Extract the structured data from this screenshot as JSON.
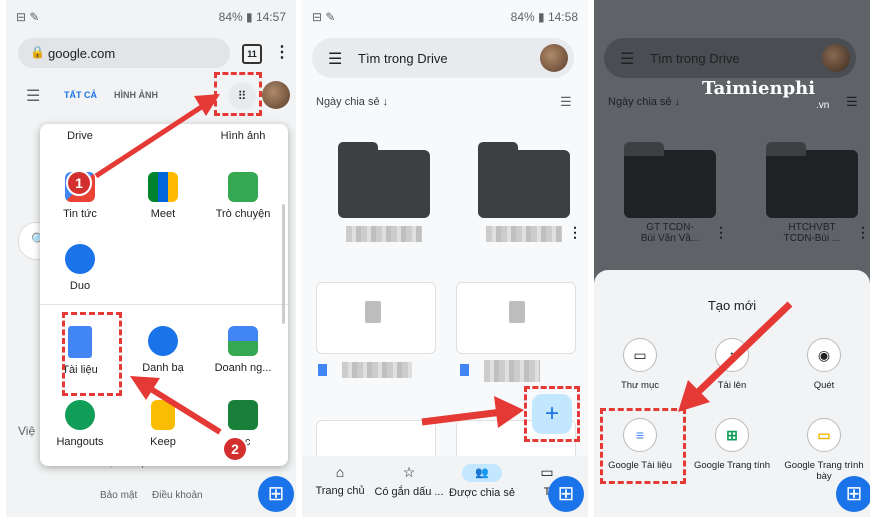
{
  "panel1": {
    "status_left": "⊟ ✎",
    "status_right": "84% ▮ 14:57",
    "url": "google.com",
    "tab_count": "11",
    "tabs": [
      "TẤT CẢ",
      "HÌNH ẢNH"
    ],
    "apps": [
      {
        "label": "Drive"
      },
      {
        "label": "Hình ảnh"
      },
      {
        "label": "Tin tức"
      },
      {
        "label": "Meet"
      },
      {
        "label": "Trò chuyện"
      },
      {
        "label": "Duo"
      },
      {
        "label": "Tài liệu"
      },
      {
        "label": "Danh bạ"
      },
      {
        "label": "Doanh ng..."
      },
      {
        "label": "Hangouts"
      },
      {
        "label": "Keep"
      },
      {
        "label": "...c"
      }
    ],
    "search_hint": "Việ",
    "bottom_text": "Giới thiệu kết quả tìm kiếm",
    "footer_links": [
      "Bảo mật",
      "Điều khoản"
    ],
    "badges": [
      "1",
      "2"
    ]
  },
  "panel2": {
    "status_left": "⊟ ✎",
    "status_right": "84% ▮ 14:58",
    "search_placeholder": "Tìm trong Drive",
    "sort_label": "Ngày chia sẻ ↓",
    "fab_label": "+",
    "nav": [
      {
        "label": "Trang chủ",
        "icon": "⌂"
      },
      {
        "label": "Có gắn dấu ...",
        "icon": "☆"
      },
      {
        "label": "Được chia sẻ",
        "icon": "👥"
      },
      {
        "label": "T",
        "icon": "▭"
      }
    ],
    "fab_corner": "⊞"
  },
  "panel3": {
    "search_placeholder": "Tìm trong Drive",
    "sort_label": "Ngày chia sẻ ↓",
    "watermark": "Taimienphi",
    "watermark_sub": ".vn",
    "folders": [
      {
        "name_line1": "GT TCDN-",
        "name_line2": "Bùi Văn Vầ..."
      },
      {
        "name_line1": "HTCHVBT",
        "name_line2": "TCDN-Bùi ..."
      }
    ],
    "sheet_title": "Tạo mới",
    "sheet_items": [
      {
        "label": "Thư mục",
        "icon": "▭"
      },
      {
        "label": "Tải lên",
        "icon": "↑"
      },
      {
        "label": "Quét",
        "icon": "◉"
      },
      {
        "label": "Google Tài liệu",
        "icon": "≡"
      },
      {
        "label": "Google Trang tính",
        "icon": "⊞"
      },
      {
        "label": "Google Trang trình bày",
        "icon": "▭"
      }
    ]
  },
  "colors": {
    "accent": "#1a73e8",
    "highlight": "#e53935",
    "dark_folder": "#3c4043"
  }
}
